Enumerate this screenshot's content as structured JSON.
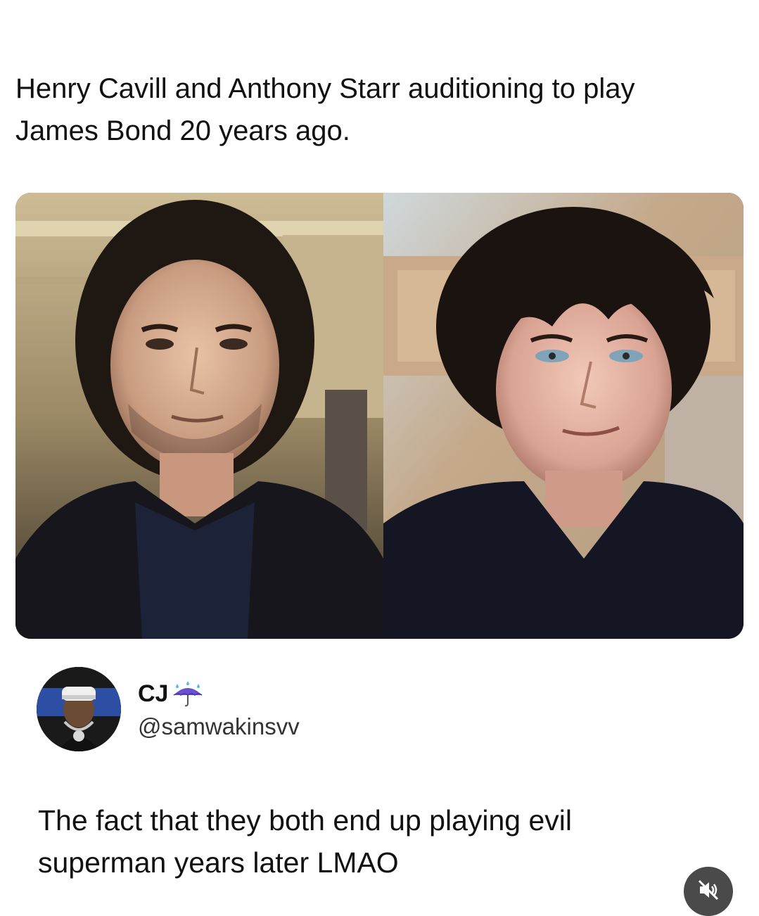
{
  "post": {
    "caption_line1": "Henry Cavill and Anthony Starr auditioning to play",
    "caption_line2": "James Bond 20 years ago."
  },
  "media": {
    "left_photo": "henry-cavill-audition-photo",
    "right_photo": "anthony-starr-audition-photo"
  },
  "tweet": {
    "display_name": "CJ",
    "name_emoji": "umbrella-with-rain-icon",
    "handle": "@samwakinsvv",
    "body_line1": "The fact that they both end up playing evil",
    "body_line2": "superman years later LMAO"
  },
  "controls": {
    "mute_icon": "speaker-muted-icon"
  },
  "colors": {
    "text": "#111111",
    "handle": "#333333",
    "background": "#ffffff",
    "mute_bg": "#4a4a4a"
  }
}
